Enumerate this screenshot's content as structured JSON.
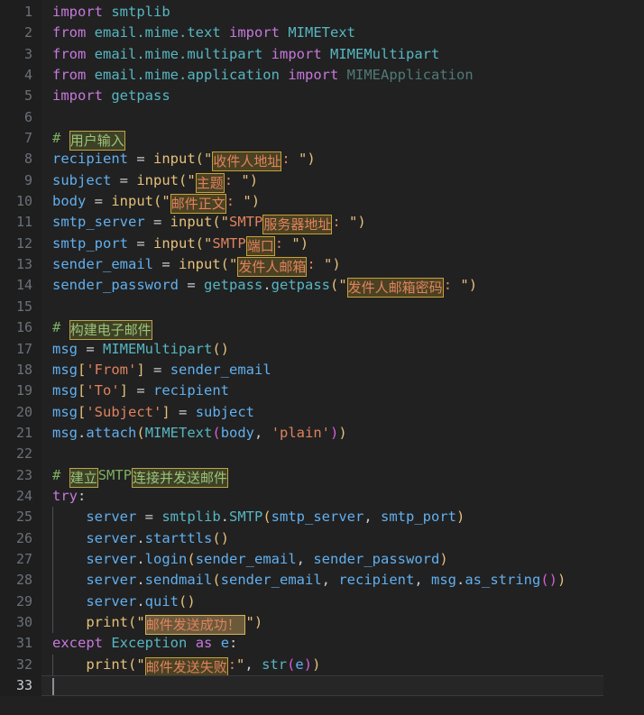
{
  "editor": {
    "name": "code-editor",
    "language": "Python",
    "background_color": "#212121",
    "gutter_color": "#1e1e1e",
    "total_lines": 33,
    "active_line": 33,
    "colors": {
      "keyword": "#c678dd",
      "module": "#56b6c2",
      "variable": "#61afef",
      "function": "#e5c07b",
      "string": "#e0825f",
      "comment": "#7fae61",
      "highlight_border": "#c8a13a",
      "highlight_fill": "#4a4222",
      "line_number": "#6b7178"
    }
  },
  "line_numbers": [
    "1",
    "2",
    "3",
    "4",
    "5",
    "6",
    "7",
    "8",
    "9",
    "10",
    "11",
    "12",
    "13",
    "14",
    "15",
    "16",
    "17",
    "18",
    "19",
    "20",
    "21",
    "22",
    "23",
    "24",
    "25",
    "26",
    "27",
    "28",
    "29",
    "30",
    "31",
    "32",
    "33"
  ],
  "code": {
    "l1": {
      "kw": "import",
      "mod": "smtplib"
    },
    "l2": {
      "kw1": "from",
      "mod": "email.mime.text",
      "kw2": "import",
      "cls": "MIMEText"
    },
    "l3": {
      "kw1": "from",
      "mod": "email.mime.multipart",
      "kw2": "import",
      "cls": "MIMEMultipart"
    },
    "l4": {
      "kw1": "from",
      "mod": "email.mime.application",
      "kw2": "import",
      "cls": "MIMEApplication"
    },
    "l5": {
      "kw": "import",
      "mod": "getpass"
    },
    "l7": {
      "hash": "#",
      "text": "用户输入"
    },
    "l8": {
      "var": "recipient",
      "eq": " = ",
      "fn": "input",
      "op": "(",
      "q1": "\"",
      "cjk": "收件人地址",
      "tail": ": ",
      "q2": "\"",
      "cp": ")"
    },
    "l9": {
      "var": "subject",
      "eq": " = ",
      "fn": "input",
      "op": "(",
      "q1": "\"",
      "cjk": "主题",
      "tail": ": ",
      "q2": "\"",
      "cp": ")"
    },
    "l10": {
      "var": "body",
      "eq": " = ",
      "fn": "input",
      "op": "(",
      "q1": "\"",
      "cjk": "邮件正文",
      "tail": ": ",
      "q2": "\"",
      "cp": ")"
    },
    "l11": {
      "var": "smtp_server",
      "eq": " = ",
      "fn": "input",
      "op": "(",
      "q1": "\"",
      "pre": "SMTP",
      "cjk": "服务器地址",
      "tail": ": ",
      "q2": "\"",
      "cp": ")"
    },
    "l12": {
      "var": "smtp_port",
      "eq": " = ",
      "fn": "input",
      "op": "(",
      "q1": "\"",
      "pre": "SMTP",
      "cjk": "端口",
      "tail": ": ",
      "q2": "\"",
      "cp": ")"
    },
    "l13": {
      "var": "sender_email",
      "eq": " = ",
      "fn": "input",
      "op": "(",
      "q1": "\"",
      "cjk": "发件人邮箱",
      "tail": ": ",
      "q2": "\"",
      "cp": ")"
    },
    "l14": {
      "var": "sender_password",
      "eq": " = ",
      "mod": "getpass",
      "dot": ".",
      "fn": "getpass",
      "op": "(",
      "q1": "\"",
      "cjk": "发件人邮箱密码",
      "tail": ": ",
      "q2": "\"",
      "cp": ")"
    },
    "l16": {
      "hash": "#",
      "text": "构建电子邮件"
    },
    "l17": {
      "var": "msg",
      "eq": " = ",
      "cls": "MIMEMultipart",
      "parens": "()"
    },
    "l18": {
      "var": "msg",
      "br1": "[",
      "str": "'From'",
      "br2": "]",
      "eq": " = ",
      "var2": "sender_email"
    },
    "l19": {
      "var": "msg",
      "br1": "[",
      "str": "'To'",
      "br2": "]",
      "eq": " = ",
      "var2": "recipient"
    },
    "l20": {
      "var": "msg",
      "br1": "[",
      "str": "'Subject'",
      "br2": "]",
      "eq": " = ",
      "var2": "subject"
    },
    "l21": {
      "var": "msg",
      "dot": ".",
      "fn": "attach",
      "op": "(",
      "cls": "MIMEText",
      "op2": "(",
      "arg1": "body",
      "comma": ", ",
      "str": "'plain'",
      "cp2": ")",
      "cp": ")"
    },
    "l23": {
      "hash": "#",
      "cjk1": "建立",
      "mid": "SMTP",
      "cjk2": "连接并发送邮件"
    },
    "l24": {
      "kw": "try",
      "colon": ":"
    },
    "l25": {
      "var": "server",
      "eq": " = ",
      "mod": "smtplib",
      "dot": ".",
      "cls": "SMTP",
      "op": "(",
      "arg1": "smtp_server",
      "comma": ", ",
      "arg2": "smtp_port",
      "cp": ")"
    },
    "l26": {
      "var": "server",
      "dot": ".",
      "fn": "starttls",
      "parens": "()"
    },
    "l27": {
      "var": "server",
      "dot": ".",
      "fn": "login",
      "op": "(",
      "arg1": "sender_email",
      "comma": ", ",
      "arg2": "sender_password",
      "cp": ")"
    },
    "l28": {
      "var": "server",
      "dot": ".",
      "fn": "sendmail",
      "op": "(",
      "arg1": "sender_email",
      "comma": ", ",
      "arg2": "recipient",
      "comma2": ", ",
      "arg3": "msg",
      "dot2": ".",
      "fn2": "as_string",
      "parens2": "()",
      "cp": ")"
    },
    "l29": {
      "var": "server",
      "dot": ".",
      "fn": "quit",
      "parens": "()"
    },
    "l30": {
      "fn": "print",
      "op": "(",
      "q1": "\"",
      "cjk": "邮件发送成功！ ",
      "q2": "\"",
      "cp": ")"
    },
    "l31": {
      "kw1": "except",
      "cls": "Exception",
      "kw2": "as",
      "var": "e",
      "colon": ":"
    },
    "l32": {
      "fn": "print",
      "op": "(",
      "q1": "\"",
      "cjk": "邮件发送失败",
      "tail": ":",
      "q2": "\"",
      "comma": ", ",
      "fn2": "str",
      "op2": "(",
      "arg": "e",
      "cp2": ")",
      "cp": ")"
    }
  }
}
